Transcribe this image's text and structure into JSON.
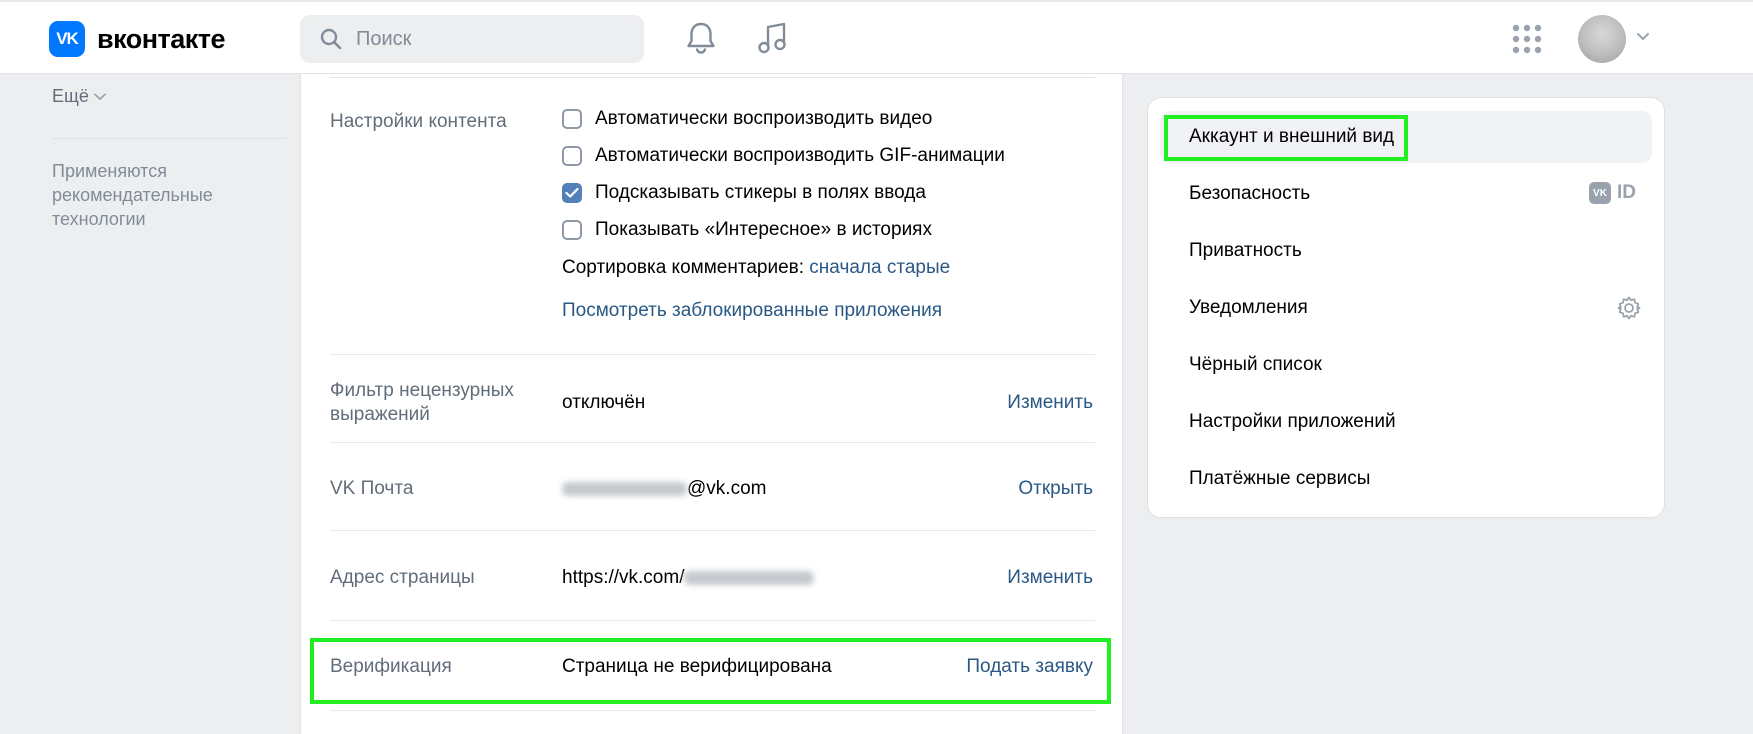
{
  "header": {
    "logo_mark": "VK",
    "logo_text": "вконтакте",
    "search_placeholder": "Поиск",
    "icons": [
      "bell-icon",
      "music-icon",
      "apps-grid-icon",
      "avatar",
      "chevron-down-icon"
    ]
  },
  "left": {
    "more_label": "Ещё",
    "note": "Применяются рекомендательные технологии"
  },
  "content_settings": {
    "label": "Настройки контента",
    "checkboxes": [
      {
        "label": "Автоматически воспроизводить видео",
        "checked": false
      },
      {
        "label": "Автоматически воспроизводить GIF-анимации",
        "checked": false
      },
      {
        "label": "Подсказывать стикеры в полях ввода",
        "checked": true
      },
      {
        "label": "Показывать «Интересное» в историях",
        "checked": false
      }
    ],
    "sort_label": "Сортировка комментариев:",
    "sort_value": "сначала старые",
    "blocked_apps_link": "Посмотреть заблокированные приложения"
  },
  "profanity_filter": {
    "label": "Фильтр нецензурных выражений",
    "value": "отключён",
    "action": "Изменить"
  },
  "vk_mail": {
    "label": "VK Почта",
    "value_suffix": "@vk.com",
    "action": "Открыть"
  },
  "page_address": {
    "label": "Адрес страницы",
    "value_prefix": "https://vk.com/",
    "action": "Изменить"
  },
  "verification": {
    "label": "Верификация",
    "value": "Страница не верифицирована",
    "action": "Подать заявку"
  },
  "side_menu": {
    "items": [
      {
        "label": "Аккаунт и внешний вид",
        "active": true
      },
      {
        "label": "Безопасность",
        "badge": "ID"
      },
      {
        "label": "Приватность"
      },
      {
        "label": "Уведомления",
        "icon": "gear-icon"
      },
      {
        "label": "Чёрный список"
      },
      {
        "label": "Настройки приложений"
      },
      {
        "label": "Платёжные сервисы"
      }
    ]
  },
  "colors": {
    "accent": "#0077ff",
    "link": "#2a5885",
    "checkbox_on": "#5181b8",
    "highlight": "#22ee22"
  }
}
